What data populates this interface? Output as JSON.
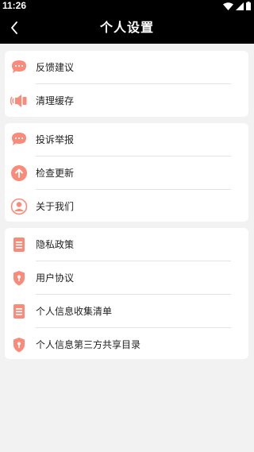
{
  "status_bar": {
    "time": "11:26"
  },
  "header": {
    "title": "个人设置"
  },
  "groups": [
    {
      "items": [
        {
          "label": "反馈建议",
          "icon": "chat-bubble-icon"
        },
        {
          "label": "清理缓存",
          "icon": "speaker-icon"
        }
      ]
    },
    {
      "items": [
        {
          "label": "投诉举报",
          "icon": "chat-bubble-icon"
        },
        {
          "label": "检查更新",
          "icon": "arrow-up-circle-icon"
        },
        {
          "label": "关于我们",
          "icon": "user-circle-icon"
        }
      ]
    },
    {
      "items": [
        {
          "label": "隐私政策",
          "icon": "document-icon"
        },
        {
          "label": "用户协议",
          "icon": "shield-icon"
        },
        {
          "label": "个人信息收集清单",
          "icon": "document-icon"
        },
        {
          "label": "个人信息第三方共享目录",
          "icon": "shield-icon"
        }
      ]
    }
  ],
  "colors": {
    "accent": "#fa8a79",
    "header_bg": "#000000",
    "page_bg": "#f2f2f2"
  }
}
